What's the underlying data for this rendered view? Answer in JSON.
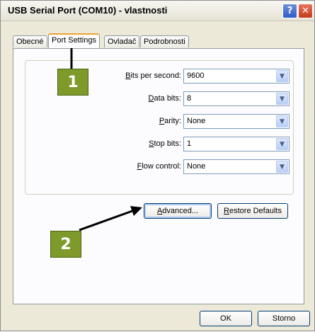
{
  "window": {
    "title": "USB Serial Port (COM10)  - vlastnosti",
    "help_label": "?",
    "close_label": "✕"
  },
  "tabs": [
    {
      "label": "Obecné",
      "active": false
    },
    {
      "label": "Port Settings",
      "active": true
    },
    {
      "label": "Ovladač",
      "active": false
    },
    {
      "label": "Podrobnosti",
      "active": false
    }
  ],
  "settings": {
    "bits_per_second": {
      "mnemonic": "B",
      "label_rest": "its per second:",
      "value": "9600"
    },
    "data_bits": {
      "mnemonic": "D",
      "label_rest": "ata bits:",
      "value": "8"
    },
    "parity": {
      "mnemonic": "P",
      "label_rest": "arity:",
      "value": "None"
    },
    "stop_bits": {
      "mnemonic": "S",
      "label_rest": "top bits:",
      "value": "1"
    },
    "flow_control": {
      "mnemonic": "F",
      "label_rest": "low control:",
      "value": "None"
    }
  },
  "buttons": {
    "advanced": {
      "mnemonic": "A",
      "rest": "dvanced..."
    },
    "restore": {
      "mnemonic": "R",
      "rest": "estore Defaults"
    },
    "ok": "OK",
    "cancel": "Storno"
  },
  "callouts": {
    "one": "1",
    "two": "2"
  },
  "colors": {
    "callout": "#7e9a2a",
    "arrow": "#000000",
    "window_bg": "#ece9d8"
  }
}
